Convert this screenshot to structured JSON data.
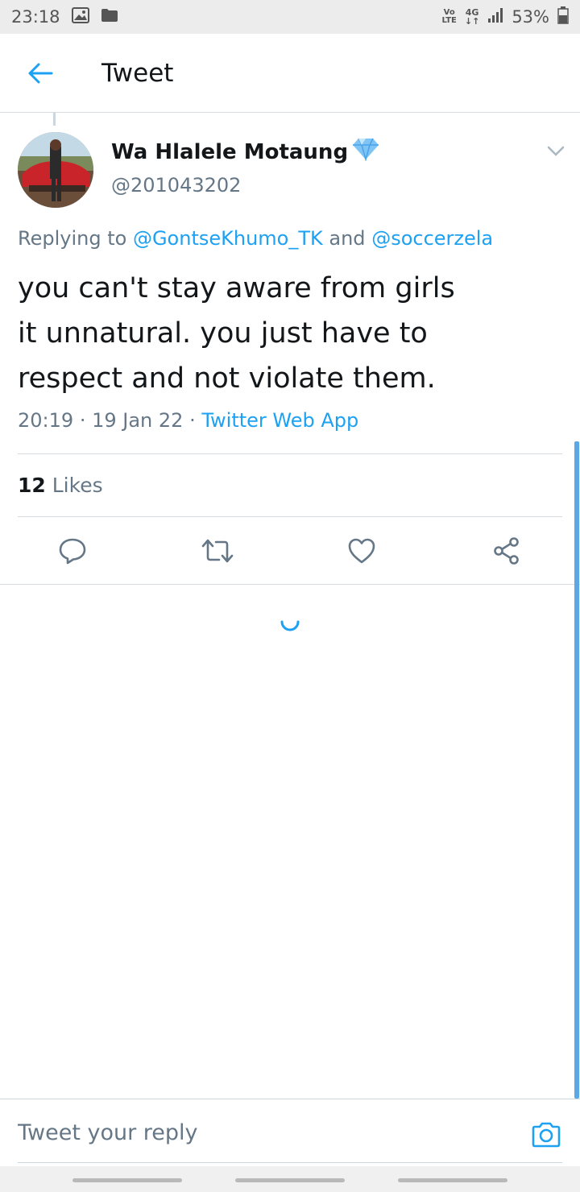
{
  "status_bar": {
    "time": "23:18",
    "volte_label": "Vo\nLTE",
    "network_label": "4G",
    "battery_percent": "53%",
    "icons": [
      "gallery-icon",
      "folder-icon",
      "volte-icon",
      "network-4g-icon",
      "signal-icon",
      "battery-icon"
    ]
  },
  "app_bar": {
    "title": "Tweet",
    "back_icon": "back-arrow-icon"
  },
  "tweet": {
    "author_name": "Wa Hlalele Motaung",
    "badge_icon": "diamond-icon",
    "handle": "@201043202",
    "replying_to_prefix": "Replying to",
    "mention_1": "@GontseKhumo_TK",
    "and_word": "and",
    "mention_2": "@soccerzela",
    "body_lines": [
      "you can't stay aware from girls",
      "it unnatural. you just have to",
      "respect and not violate them."
    ],
    "time": "20:19",
    "date": "19 Jan 22",
    "source": "Twitter Web App",
    "likes_count": "12",
    "likes_label": "Likes"
  },
  "actions": [
    "reply-icon",
    "retweet-icon",
    "like-icon",
    "share-icon"
  ],
  "composer": {
    "placeholder": "Tweet your reply",
    "camera_icon": "camera-icon"
  },
  "colors": {
    "accent": "#1da1f2",
    "secondary_text": "#657786",
    "divider": "#d6dbdf",
    "status_bar_bg": "#ececec"
  }
}
